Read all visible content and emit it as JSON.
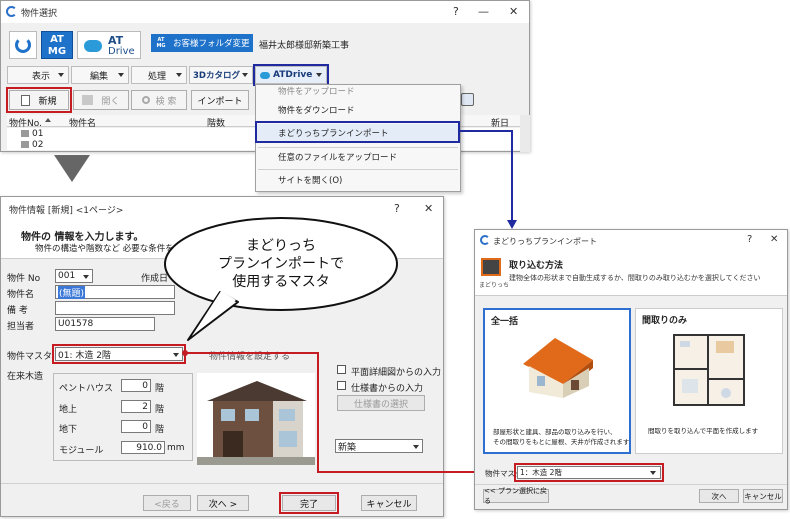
{
  "win1": {
    "title": "物件選択",
    "help": "?",
    "min": "—",
    "close": "✕",
    "logo_at_line1": "AT",
    "logo_at_line2": "MG",
    "atdrive_line1": "AT",
    "atdrive_line2": "Drive",
    "folder_btn_logo1": "AT",
    "folder_btn_logo2": "MG",
    "folder_btn_label": "お客様フォルダ変更",
    "customer_folder": "福井太郎様邸新築工事",
    "menu": [
      "表示",
      "編集",
      "処理",
      "3Dカタログ",
      "ATDrive"
    ],
    "toolbar": {
      "new": "新規",
      "open": "開く",
      "search": "検 索",
      "import": "インポート"
    },
    "table": {
      "col1": "物件No.",
      "col2": "物件名",
      "col3": "階数",
      "col4": "新日"
    },
    "rows": [
      "01",
      "02"
    ]
  },
  "dropdown": {
    "items": [
      "物件をアップロード",
      "物件をダウンロード",
      "まどりっちプランインポート",
      "任意のファイルをアップロード",
      "サイトを開く(O)"
    ]
  },
  "win2": {
    "title": "物件情報 [新規] <1ページ>",
    "help": "?",
    "close": "✕",
    "heading": "物件の 情報を入力します。",
    "subheading": "物件の構造や階数など 必要な条件を入力",
    "fields": {
      "no_label": "物件 No",
      "no_value": "001",
      "date_label": "作成日",
      "name_label": "物件名",
      "name_value": "(無題)",
      "note_label": "備 考",
      "person_label": "担当者",
      "person_value": "U01578",
      "master_label": "物件マスタ",
      "master_value": "01: 木造 2階",
      "master_caption": "物件情報を設定する",
      "structure_label": "在来木造",
      "penthouse_label": "ペントハウス",
      "penthouse_value": "0",
      "above_label": "地上",
      "above_value": "2",
      "below_label": "地下",
      "below_value": "0",
      "floor_unit": "階",
      "module_label": "モジュール",
      "module_value": "910.0",
      "module_unit": "mm"
    },
    "checks": [
      "平面詳細図からの入力",
      "仕様書からの入力"
    ],
    "spec_select_btn": "仕様書の選択",
    "build_type": "新築",
    "footer": {
      "back": "<戻る",
      "next": "次へ >",
      "finish": "完了",
      "cancel": "キャンセル"
    }
  },
  "bubble": {
    "line1": "まどりっち",
    "line2": "プランインポートで",
    "line3": "使用するマスタ"
  },
  "win3": {
    "title": "まどりっちプランインポート",
    "help": "?",
    "close": "✕",
    "icon_caption": "まどりっち",
    "heading": "取り込む方法",
    "description": "建物全体の形状まで自動生成するか、間取りのみ取り込むかを選択してください",
    "option1_title": "全一括",
    "option1_desc1": "部屋形状と建具、部品の取り込みを行い、",
    "option1_desc2": "その間取りをもとに屋根、天井が作成されます",
    "option2_title": "間取りのみ",
    "option2_desc": "間取りを取り込んで平面を作成します",
    "master_label": "物件マスタ",
    "master_value": "1：木造 2階",
    "footer": {
      "back": "<< プラン選択に戻る",
      "next": "次へ",
      "cancel": "キャンセル"
    }
  },
  "colors": {
    "red": "#c41c22",
    "blue": "#1f2aa0",
    "at_blue": "#1f72c9"
  }
}
